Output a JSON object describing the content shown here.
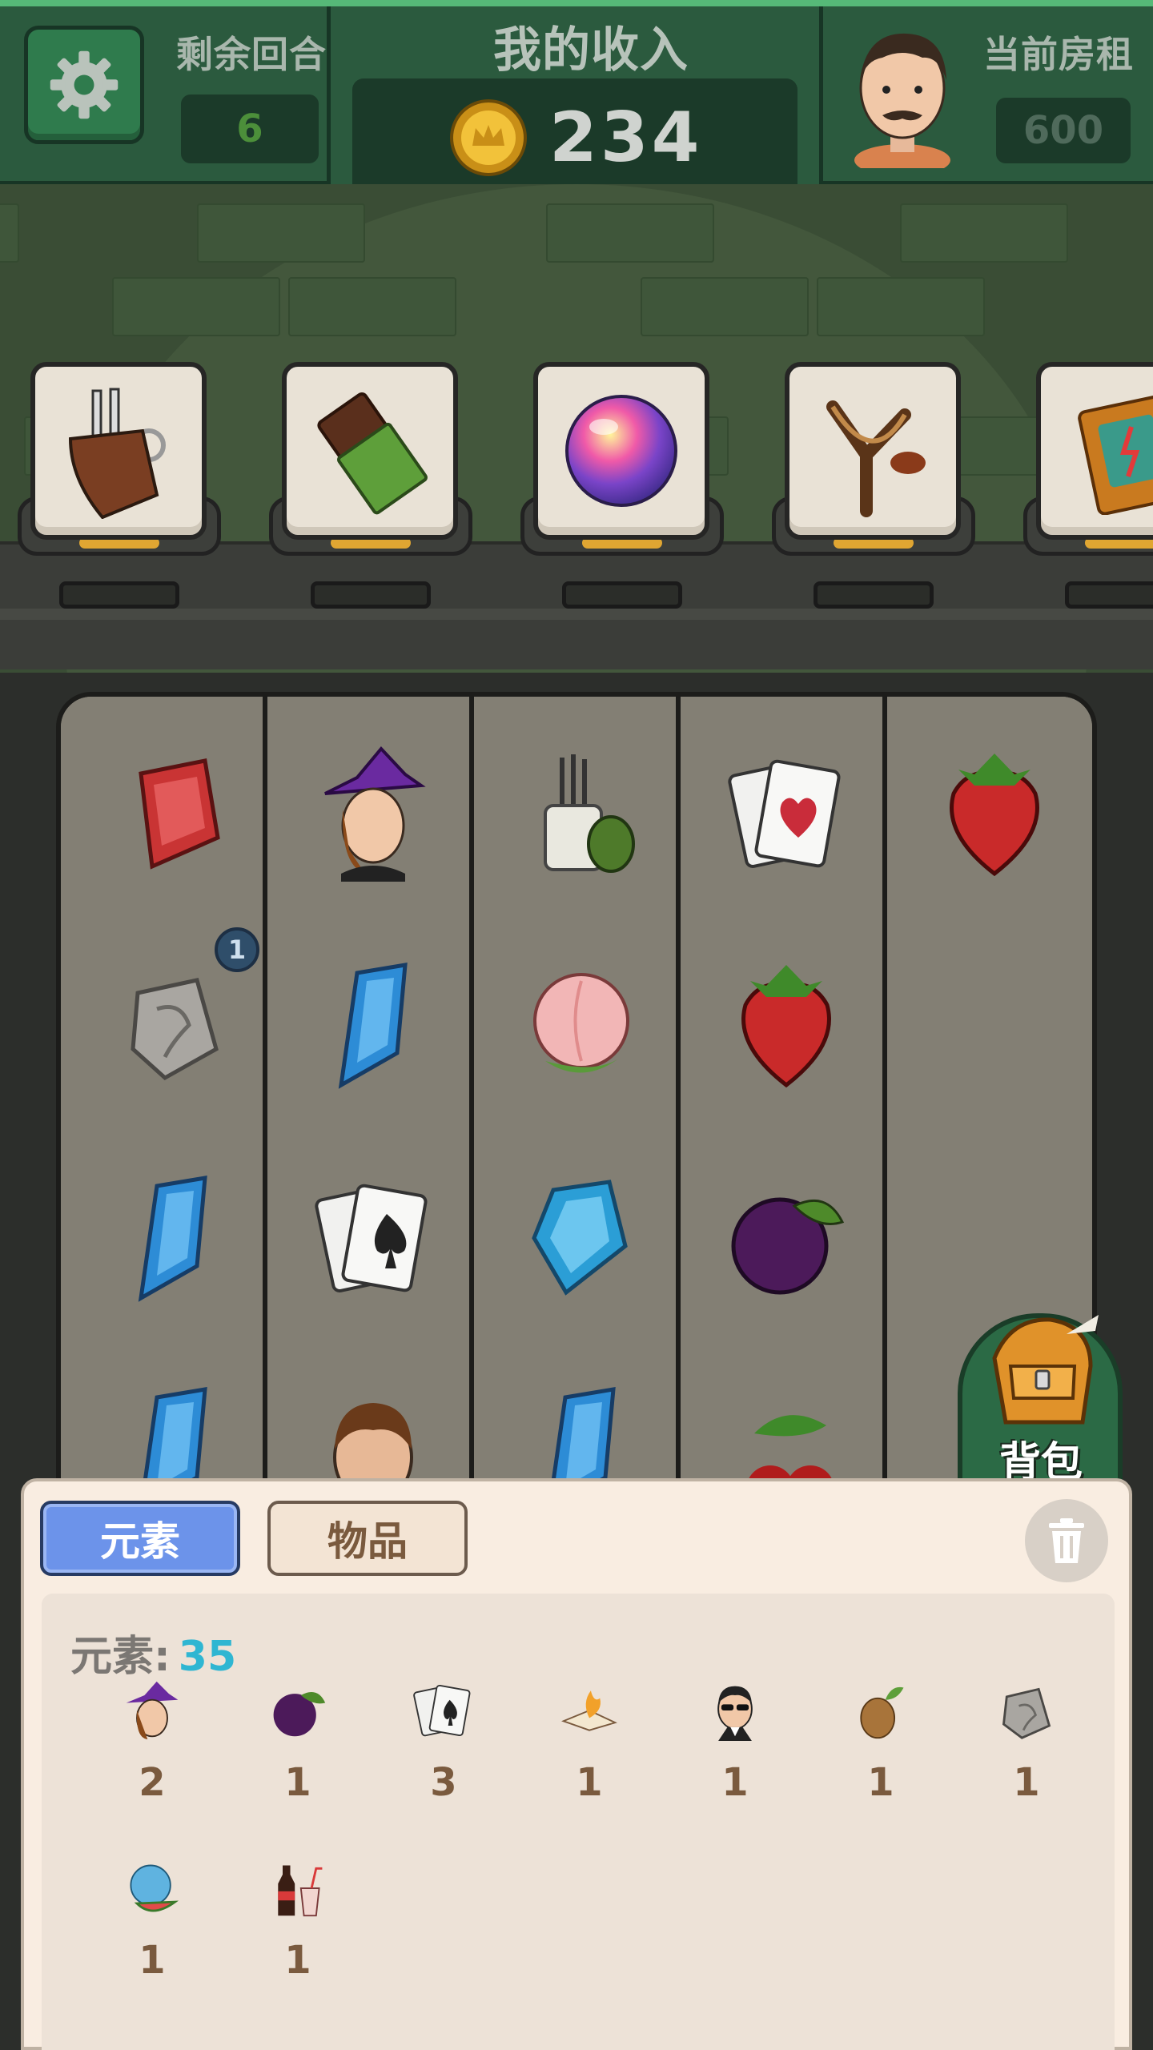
{
  "hud": {
    "rounds_label": "剩余回合",
    "rounds_value": "6",
    "income_label": "我的收入",
    "income_value": "234",
    "rent_label": "当前房租",
    "rent_value": "600"
  },
  "showcase": {
    "items": [
      "tool-bag",
      "chocolate",
      "rainbow-orb",
      "slingshot",
      "spell-book"
    ]
  },
  "board": {
    "reels": [
      [
        "red-gem",
        "stone-tablet",
        "blue-crystal",
        "blue-crystal"
      ],
      [
        "witch",
        "blue-crystal",
        "spade-cards",
        "boy"
      ],
      [
        "brush-pot",
        "peach",
        "blue-crystal",
        "blue-crystal"
      ],
      [
        "heart-cards",
        "strawberry",
        "plum",
        "cherries"
      ],
      [
        "strawberry",
        "",
        "",
        ""
      ]
    ],
    "bubble_value": "1"
  },
  "backpack": {
    "label": "背包"
  },
  "panel": {
    "tab_elements": "元素",
    "tab_items": "物品",
    "count_label": "元素:",
    "count_value": "35",
    "items": [
      {
        "icon": "witch",
        "count": "2"
      },
      {
        "icon": "plum",
        "count": "1"
      },
      {
        "icon": "spade-cards",
        "count": "3"
      },
      {
        "icon": "flame-scroll",
        "count": "1"
      },
      {
        "icon": "sunglasses-man",
        "count": "1"
      },
      {
        "icon": "seed",
        "count": "1"
      },
      {
        "icon": "stone-tablet",
        "count": "1"
      },
      {
        "icon": "watermelon",
        "count": "1"
      },
      {
        "icon": "soda",
        "count": "1"
      }
    ]
  },
  "colors": {
    "hud_green": "#2b5a3e",
    "tab_active": "#6c93ea",
    "count_accent": "#2fb6d2",
    "count_text": "#7a5a3e"
  }
}
